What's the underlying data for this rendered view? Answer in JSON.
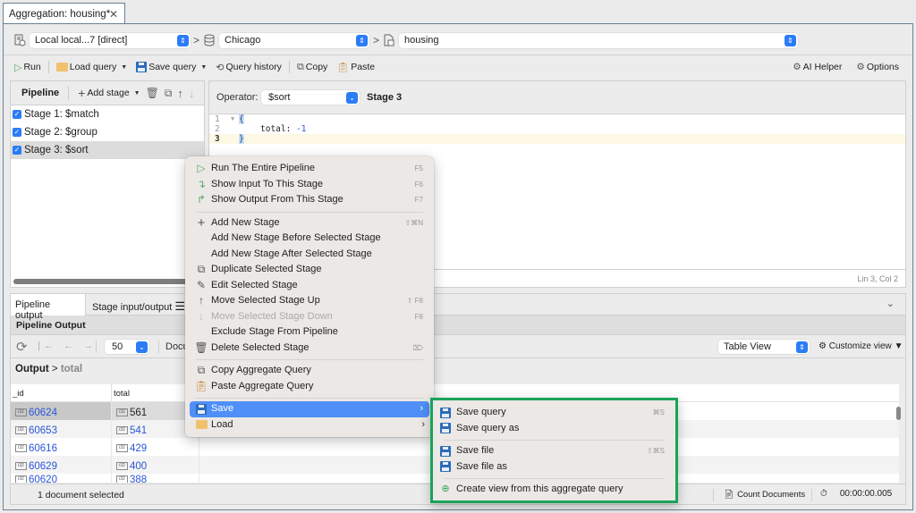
{
  "tab": {
    "title": "Aggregation: housing*",
    "close_icon": "close-icon"
  },
  "connection": {
    "server": "Local local...7 [direct]",
    "database": "Chicago",
    "collection": "housing"
  },
  "toolbar": {
    "run": "Run",
    "load_query": "Load query",
    "save_query": "Save query",
    "query_history": "Query history",
    "copy": "Copy",
    "paste": "Paste",
    "ai_helper": "AI Helper",
    "options": "Options"
  },
  "pipeline": {
    "title": "Pipeline",
    "add_stage": "Add stage",
    "stages": [
      {
        "label": "Stage 1: $match",
        "checked": true
      },
      {
        "label": "Stage 2: $group",
        "checked": true
      },
      {
        "label": "Stage 3: $sort",
        "checked": true,
        "selected": true
      }
    ]
  },
  "editor": {
    "operator_label": "Operator:",
    "operator_value": "$sort",
    "stage_label": "Stage 3",
    "lines": [
      {
        "n": "1",
        "text_open": "{"
      },
      {
        "n": "2",
        "key": "total: ",
        "value": "-1"
      },
      {
        "n": "3",
        "text_close": "}"
      }
    ],
    "cursor_status": "Lin 3, Col 2"
  },
  "output": {
    "tabs": [
      "Pipeline output",
      "Stage input/output"
    ],
    "title": "Pipeline Output",
    "page_size": "50",
    "documents_label": "Docu",
    "view_mode": "Table View",
    "customize_view": "Customize view",
    "breadcrumb_root": "Output",
    "breadcrumb_sub": "total",
    "columns": [
      "_id",
      "total"
    ],
    "rows": [
      {
        "id": "60624",
        "total": "561"
      },
      {
        "id": "60653",
        "total": "541"
      },
      {
        "id": "60616",
        "total": "429"
      },
      {
        "id": "60629",
        "total": "400"
      },
      {
        "id": "60620",
        "total": "388"
      }
    ],
    "status_selected": "1 document selected",
    "count_documents": "Count Documents",
    "elapsed": "00:00:00.005"
  },
  "context_menu": {
    "items": [
      {
        "label": "Run The Entire Pipeline",
        "shortcut": "F5",
        "icon": "play-icon"
      },
      {
        "label": "Show Input To This Stage",
        "shortcut": "F6",
        "icon": "show-input-icon"
      },
      {
        "label": "Show Output From This Stage",
        "shortcut": "F7",
        "icon": "show-output-icon"
      },
      {
        "label": "Add New Stage",
        "shortcut": "⇧⌘N",
        "icon": "plus-icon"
      },
      {
        "label": "Add New Stage Before Selected Stage",
        "shortcut": ""
      },
      {
        "label": "Add New Stage After Selected Stage",
        "shortcut": ""
      },
      {
        "label": "Duplicate Selected Stage",
        "shortcut": "",
        "icon": "duplicate-icon"
      },
      {
        "label": "Edit Selected Stage",
        "shortcut": "",
        "icon": "edit-icon"
      },
      {
        "label": "Move Selected Stage Up",
        "shortcut": "⇧ F8",
        "icon": "arrow-up-icon"
      },
      {
        "label": "Move Selected Stage Down",
        "shortcut": "F8",
        "icon": "arrow-down-icon",
        "disabled": true
      },
      {
        "label": "Exclude Stage From Pipeline",
        "shortcut": ""
      },
      {
        "label": "Delete Selected Stage",
        "shortcut": "⌦",
        "icon": "trash-icon"
      },
      {
        "label": "Copy Aggregate Query",
        "shortcut": "",
        "icon": "copy-icon"
      },
      {
        "label": "Paste Aggregate Query",
        "shortcut": "",
        "icon": "paste-icon"
      },
      {
        "label": "Save",
        "submenu": true,
        "highlighted": true,
        "icon": "save-icon"
      },
      {
        "label": "Load",
        "submenu": true,
        "icon": "folder-icon"
      }
    ]
  },
  "save_submenu": {
    "items": [
      {
        "label": "Save query",
        "shortcut": "⌘S"
      },
      {
        "label": "Save query as",
        "shortcut": ""
      },
      {
        "label": "Save file",
        "shortcut": "⇧⌘S"
      },
      {
        "label": "Save file as",
        "shortcut": ""
      },
      {
        "label": "Create view from this aggregate query",
        "shortcut": ""
      }
    ],
    "highlight_color": "#1aa35a"
  },
  "colors": {
    "accent": "#2b7cf6",
    "menu_highlight": "#4f8ff7",
    "link_value": "#2b56d9"
  }
}
